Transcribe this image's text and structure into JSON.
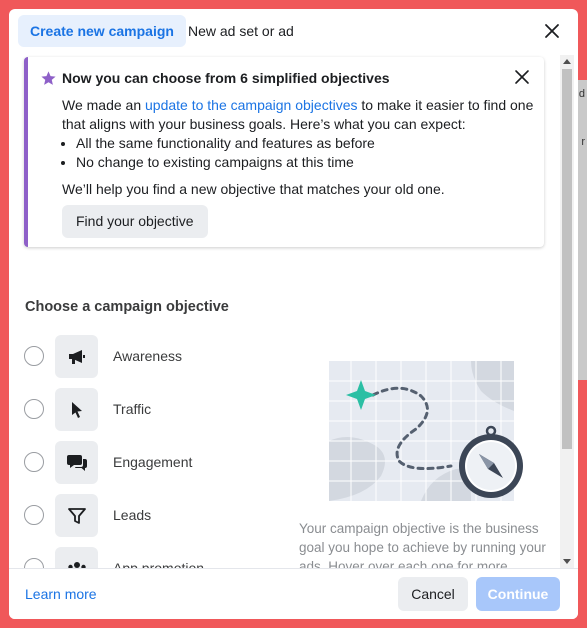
{
  "colors": {
    "page_border": "#f0585a",
    "accent": "#1b74e4",
    "tab_active_bg": "#e7f0fd",
    "banner_accent": "#8e60c8",
    "continue_disabled": "#a8c7fa",
    "map_marker": "#2bbfa4"
  },
  "header": {
    "tabs": [
      {
        "label": "Create new campaign",
        "active": true
      },
      {
        "label": "New ad set or ad",
        "active": false
      }
    ],
    "close_icon": "close-icon"
  },
  "banner": {
    "icon": "star-icon",
    "title": "Now you can choose from 6 simplified objectives",
    "body_prefix": "We made an ",
    "link_text": "update to the campaign objectives",
    "body_suffix": " to make it easier to find one that aligns with your business goals. Here’s what you can expect:",
    "bullets": [
      "All the same functionality and features as before",
      "No change to existing campaigns at this time"
    ],
    "note": "We’ll help you find a new objective that matches your old one.",
    "button_label": "Find your objective"
  },
  "objectives_section": {
    "title": "Choose a campaign objective",
    "items": [
      {
        "label": "Awareness",
        "icon": "megaphone-icon",
        "selected": false
      },
      {
        "label": "Traffic",
        "icon": "cursor-icon",
        "selected": false
      },
      {
        "label": "Engagement",
        "icon": "chat-bubbles-icon",
        "selected": false
      },
      {
        "label": "Leads",
        "icon": "funnel-icon",
        "selected": false
      },
      {
        "label": "App promotion",
        "icon": "people-icon",
        "selected": false
      }
    ],
    "helper_text": "Your campaign objective is the business goal you hope to achieve by running your ads. Hover over each one for more"
  },
  "footer": {
    "learn_more": "Learn more",
    "cancel": "Cancel",
    "continue": "Continue",
    "continue_enabled": false
  }
}
